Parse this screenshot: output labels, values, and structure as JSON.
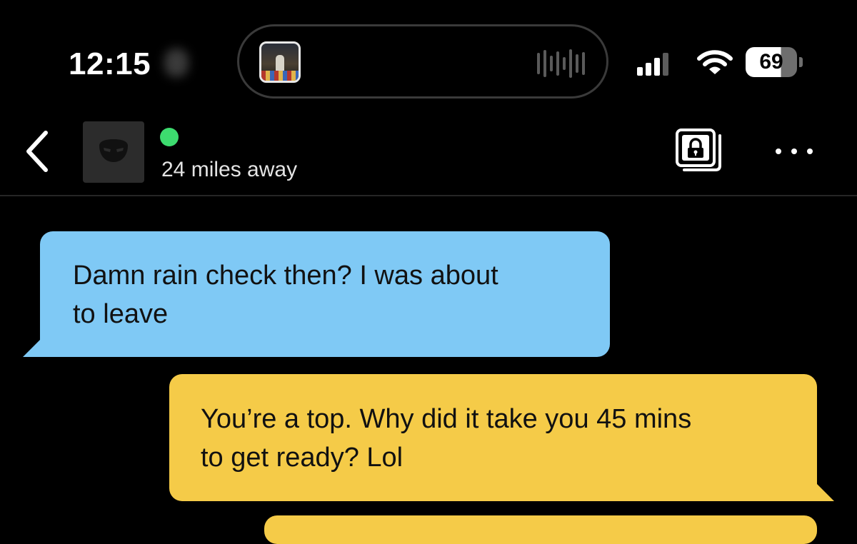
{
  "status_bar": {
    "time": "12:15",
    "battery_level": 69,
    "battery_label": "69",
    "signal_bars_active": 3,
    "signal_bars_total": 4,
    "icons": {
      "signal": "cellular-signal-icon",
      "wifi": "wifi-icon",
      "battery": "battery-icon"
    }
  },
  "now_playing": {
    "icons": {
      "album_art": "album-art-icon",
      "waveform": "audio-waveform-icon"
    }
  },
  "chat_header": {
    "distance": "24 miles away",
    "online": true,
    "icons": {
      "back": "chevron-left-icon",
      "avatar": "mask-avatar-icon",
      "private_album": "locked-album-icon",
      "more": "more-horizontal-icon"
    }
  },
  "messages": [
    {
      "direction": "received",
      "lines": [
        "Damn rain check then? I was about",
        "to leave"
      ]
    },
    {
      "direction": "sent",
      "lines": [
        "You’re a top. Why did it take you 45 mins",
        "to get ready? Lol"
      ]
    }
  ],
  "colors": {
    "background": "#000000",
    "received_bubble": "#7fc9f5",
    "sent_bubble": "#f5cb48",
    "online_indicator": "#3ddc6f"
  }
}
